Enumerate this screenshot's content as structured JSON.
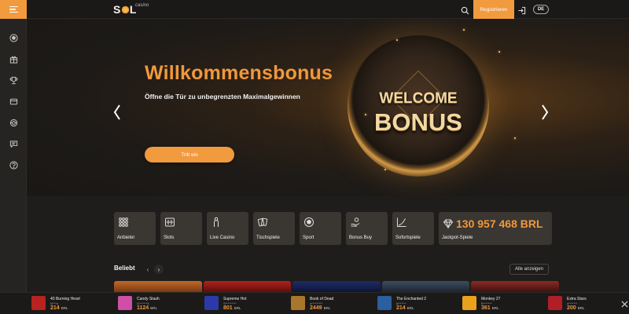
{
  "header": {
    "logo_text": "SOL",
    "logo_sub": "casino",
    "register_label": "Registrieren",
    "lang_label": "DE"
  },
  "sidebar": {
    "icons": [
      "soccer-ball-icon",
      "gift-icon",
      "trophy-icon",
      "wallet-icon",
      "support-icon",
      "chat-icon",
      "help-icon"
    ]
  },
  "hero": {
    "title": "Willkommensbonus",
    "subtitle": "Öffne die Tür zu unbegrenzten Maximalgewinnen",
    "cta_label": "Tritt ein",
    "coin_line1": "WELCOME",
    "coin_line2": "BONUS"
  },
  "categories": [
    {
      "label": "Anbieter",
      "icon": "grid-icon"
    },
    {
      "label": "Slots",
      "icon": "slot-machine-icon"
    },
    {
      "label": "Live Casino",
      "icon": "dealer-icon"
    },
    {
      "label": "Tischspiele",
      "icon": "cards-icon"
    },
    {
      "label": "Sport",
      "icon": "soccer-ball-icon"
    },
    {
      "label": "Bonus Buy",
      "icon": "hand-coin-icon"
    },
    {
      "label": "Sofortspiele",
      "icon": "chart-line-icon"
    }
  ],
  "jackpot": {
    "amount": "130 957 468 BRL",
    "label": "Jackpot-Spiele"
  },
  "popular": {
    "title": "Beliebt",
    "show_all_label": "Alle anzeigen"
  },
  "ticker": [
    {
      "game": "40 Burning Heart",
      "user": "M***o",
      "amount": "214",
      "currency": "BRL",
      "color": "#b8231f"
    },
    {
      "game": "Candy Stash",
      "user": "A*******k",
      "amount": "1124",
      "currency": "BRL",
      "color": "#d04fa6"
    },
    {
      "game": "Supreme Hot",
      "user": "S*********",
      "amount": "801",
      "currency": "BRL",
      "color": "#2b3aa8"
    },
    {
      "game": "Book of Dead",
      "user": "a*********",
      "amount": "2449",
      "currency": "BRL",
      "color": "#a8772c"
    },
    {
      "game": "The Enchanted 2",
      "user": "M******",
      "amount": "214",
      "currency": "BRL",
      "color": "#2a5fa0"
    },
    {
      "game": "Monkey 27",
      "user": "B*******",
      "amount": "361",
      "currency": "BRL",
      "color": "#e8a21c"
    },
    {
      "game": "Extra Stars",
      "user": "a*******",
      "amount": "200",
      "currency": "BRL",
      "color": "#b01e26"
    }
  ]
}
